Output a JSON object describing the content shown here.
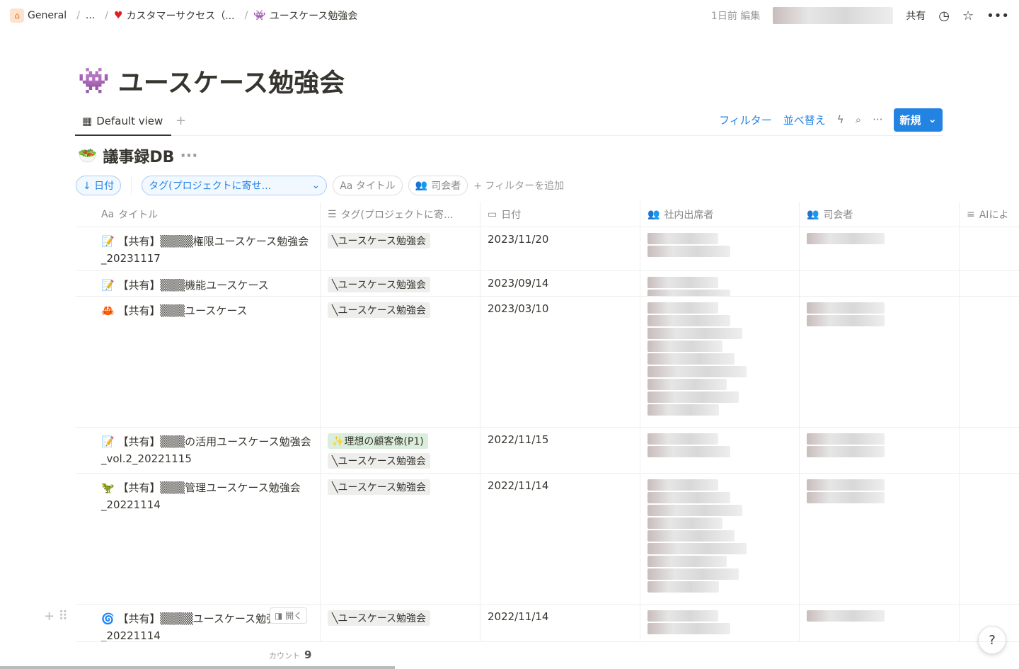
{
  "breadcrumb": [
    "General",
    "...",
    "カスタマーサクセス（...",
    "ユースケース勉強会"
  ],
  "topbar": {
    "edited": "1日前 編集",
    "share": "共有"
  },
  "page_title": "ユースケース勉強会",
  "view": {
    "tab": "Default view",
    "add": "+",
    "filter": "フィルター",
    "sort": "並べ替え",
    "new": "新規"
  },
  "db_title": "議事録DB",
  "filters": {
    "sort": "↓ 日付",
    "tag": "タグ(プロジェクトに寄せ...",
    "title": "Aa タイトル",
    "host": "司会者",
    "add": "+ フィルターを追加"
  },
  "columns": [
    "タイトル",
    "タグ(プロジェクトに寄...",
    "日付",
    "社内出席者",
    "司会者",
    "AIによ"
  ],
  "rows": [
    {
      "icon": "📝",
      "title": "【共有】▒▒▒▒権限ユースケース勉強会_20231117",
      "tags": [
        "ユースケース勉強会"
      ],
      "date": "2023/11/20",
      "att": 2,
      "host": 1
    },
    {
      "icon": "📝",
      "title": "【共有】▒▒▒機能ユースケース",
      "tags": [
        "ユースケース勉強会"
      ],
      "date": "2023/09/14",
      "att": 2,
      "host": 0
    },
    {
      "icon": "🦀",
      "title": "【共有】▒▒▒ユースケース",
      "tags": [
        "ユースケース勉強会"
      ],
      "date": "2023/03/10",
      "att": 9,
      "host": 2
    },
    {
      "icon": "📝",
      "title": "【共有】▒▒▒の活用ユースケース勉強会_vol.2_20221115",
      "tags": [
        "✨理想の顧客像(P1)",
        "ユースケース勉強会"
      ],
      "date": "2022/11/15",
      "att": 2,
      "host": 2
    },
    {
      "icon": "🦖",
      "title": "【共有】▒▒▒管理ユースケース勉強会_20221114",
      "tags": [
        "ユースケース勉強会"
      ],
      "date": "2022/11/14",
      "att": 9,
      "host": 2
    },
    {
      "icon": "🌀",
      "title": "【共有】▒▒▒▒ユースケース勉強会_20221114",
      "tags": [
        "ユースケース勉強会"
      ],
      "date": "2022/11/14",
      "att": 2,
      "host": 1
    }
  ],
  "open_label": "開く",
  "count_label": "カウント",
  "count": "9",
  "help": "?"
}
